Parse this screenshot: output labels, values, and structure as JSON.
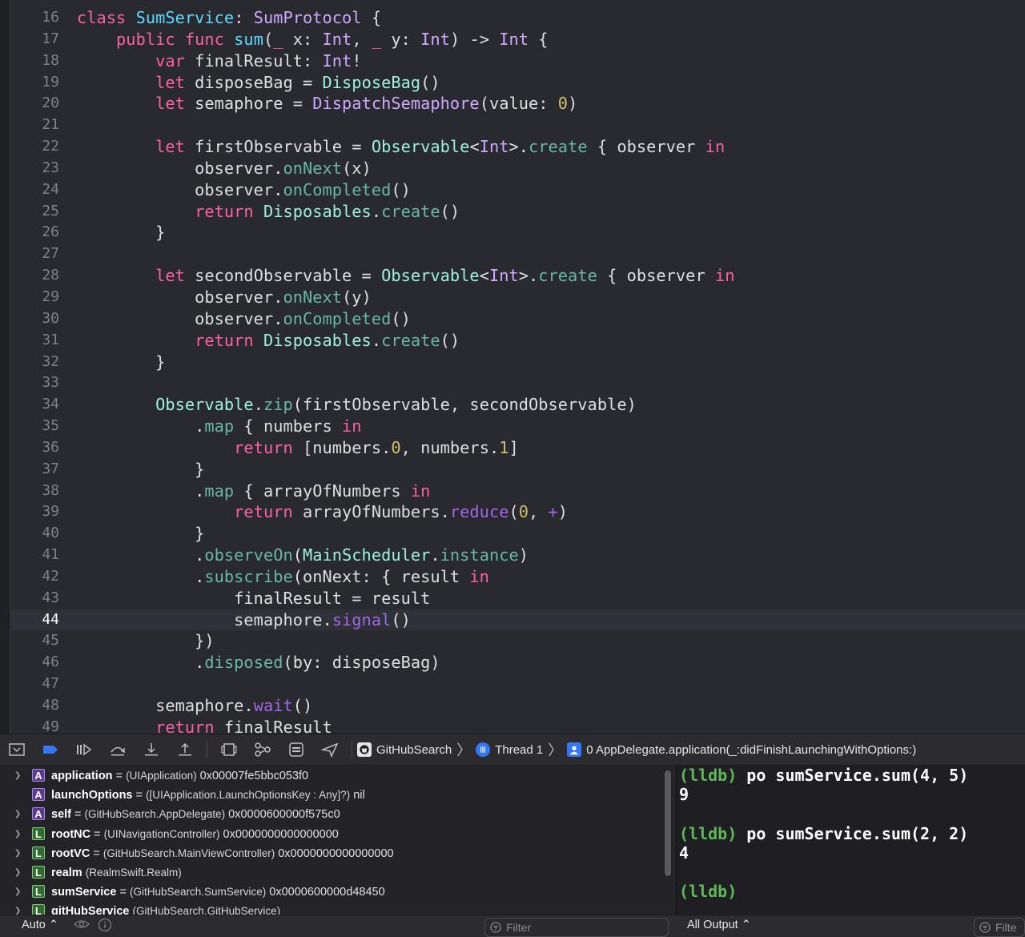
{
  "editor": {
    "current_line": 44,
    "lines": [
      {
        "n": "16",
        "t": [
          {
            "c": "kw",
            "t": "class "
          },
          {
            "c": "tyd",
            "t": "SumService"
          },
          {
            "t": ": "
          },
          {
            "c": "ty",
            "t": "SumProtocol"
          },
          {
            "t": " {"
          }
        ]
      },
      {
        "n": "17",
        "t": [
          {
            "t": "    "
          },
          {
            "c": "kw",
            "t": "public func "
          },
          {
            "c": "tyd",
            "t": "sum"
          },
          {
            "t": "("
          },
          {
            "c": "kw",
            "t": "_"
          },
          {
            "t": " x: "
          },
          {
            "c": "ty",
            "t": "Int"
          },
          {
            "t": ", "
          },
          {
            "c": "kw",
            "t": "_"
          },
          {
            "t": " y: "
          },
          {
            "c": "ty",
            "t": "Int"
          },
          {
            "t": ") -> "
          },
          {
            "c": "ty",
            "t": "Int"
          },
          {
            "t": " {"
          }
        ]
      },
      {
        "n": "18",
        "t": [
          {
            "t": "        "
          },
          {
            "c": "kw",
            "t": "var"
          },
          {
            "t": " finalResult: "
          },
          {
            "c": "ty",
            "t": "Int"
          },
          {
            "t": "!"
          }
        ]
      },
      {
        "n": "19",
        "t": [
          {
            "t": "        "
          },
          {
            "c": "kw",
            "t": "let"
          },
          {
            "t": " disposeBag = "
          },
          {
            "c": "pt",
            "t": "DisposeBag"
          },
          {
            "t": "()"
          }
        ]
      },
      {
        "n": "20",
        "t": [
          {
            "t": "        "
          },
          {
            "c": "kw",
            "t": "let"
          },
          {
            "t": " semaphore = "
          },
          {
            "c": "ty",
            "t": "DispatchSemaphore"
          },
          {
            "t": "(value: "
          },
          {
            "c": "num",
            "t": "0"
          },
          {
            "t": ")"
          }
        ]
      },
      {
        "n": "21",
        "t": []
      },
      {
        "n": "22",
        "t": [
          {
            "t": "        "
          },
          {
            "c": "kw",
            "t": "let"
          },
          {
            "t": " firstObservable = "
          },
          {
            "c": "pt",
            "t": "Observable"
          },
          {
            "t": "<"
          },
          {
            "c": "ty",
            "t": "Int"
          },
          {
            "t": ">."
          },
          {
            "c": "pn",
            "t": "create"
          },
          {
            "t": " { observer "
          },
          {
            "c": "kw",
            "t": "in"
          }
        ]
      },
      {
        "n": "23",
        "t": [
          {
            "t": "            observer."
          },
          {
            "c": "pn",
            "t": "onNext"
          },
          {
            "t": "(x)"
          }
        ]
      },
      {
        "n": "24",
        "t": [
          {
            "t": "            observer."
          },
          {
            "c": "pn",
            "t": "onCompleted"
          },
          {
            "t": "()"
          }
        ]
      },
      {
        "n": "25",
        "t": [
          {
            "t": "            "
          },
          {
            "c": "kw",
            "t": "return "
          },
          {
            "c": "pt",
            "t": "Disposables"
          },
          {
            "t": "."
          },
          {
            "c": "pn",
            "t": "create"
          },
          {
            "t": "()"
          }
        ]
      },
      {
        "n": "26",
        "t": [
          {
            "t": "        }"
          }
        ]
      },
      {
        "n": "27",
        "t": []
      },
      {
        "n": "28",
        "t": [
          {
            "t": "        "
          },
          {
            "c": "kw",
            "t": "let"
          },
          {
            "t": " secondObservable = "
          },
          {
            "c": "pt",
            "t": "Observable"
          },
          {
            "t": "<"
          },
          {
            "c": "ty",
            "t": "Int"
          },
          {
            "t": ">."
          },
          {
            "c": "pn",
            "t": "create"
          },
          {
            "t": " { observer "
          },
          {
            "c": "kw",
            "t": "in"
          }
        ]
      },
      {
        "n": "29",
        "t": [
          {
            "t": "            observer."
          },
          {
            "c": "pn",
            "t": "onNext"
          },
          {
            "t": "(y)"
          }
        ]
      },
      {
        "n": "30",
        "t": [
          {
            "t": "            observer."
          },
          {
            "c": "pn",
            "t": "onCompleted"
          },
          {
            "t": "()"
          }
        ]
      },
      {
        "n": "31",
        "t": [
          {
            "t": "            "
          },
          {
            "c": "kw",
            "t": "return "
          },
          {
            "c": "pt",
            "t": "Disposables"
          },
          {
            "t": "."
          },
          {
            "c": "pn",
            "t": "create"
          },
          {
            "t": "()"
          }
        ]
      },
      {
        "n": "32",
        "t": [
          {
            "t": "        }"
          }
        ]
      },
      {
        "n": "33",
        "t": []
      },
      {
        "n": "34",
        "t": [
          {
            "t": "        "
          },
          {
            "c": "pt",
            "t": "Observable"
          },
          {
            "t": "."
          },
          {
            "c": "pn",
            "t": "zip"
          },
          {
            "t": "(firstObservable, secondObservable)"
          }
        ]
      },
      {
        "n": "35",
        "t": [
          {
            "t": "            ."
          },
          {
            "c": "pn",
            "t": "map"
          },
          {
            "t": " { numbers "
          },
          {
            "c": "kw",
            "t": "in"
          }
        ]
      },
      {
        "n": "36",
        "t": [
          {
            "t": "                "
          },
          {
            "c": "kw",
            "t": "return"
          },
          {
            "t": " [numbers."
          },
          {
            "c": "num",
            "t": "0"
          },
          {
            "t": ", numbers."
          },
          {
            "c": "num",
            "t": "1"
          },
          {
            "t": "]"
          }
        ]
      },
      {
        "n": "37",
        "t": [
          {
            "t": "            }"
          }
        ]
      },
      {
        "n": "38",
        "t": [
          {
            "t": "            ."
          },
          {
            "c": "pn",
            "t": "map"
          },
          {
            "t": " { arrayOfNumbers "
          },
          {
            "c": "kw",
            "t": "in"
          }
        ]
      },
      {
        "n": "39",
        "t": [
          {
            "t": "                "
          },
          {
            "c": "kw",
            "t": "return"
          },
          {
            "t": " arrayOfNumbers."
          },
          {
            "c": "pj",
            "t": "reduce"
          },
          {
            "t": "("
          },
          {
            "c": "num",
            "t": "0"
          },
          {
            "t": ", "
          },
          {
            "c": "pj",
            "t": "+"
          },
          {
            "t": ")"
          }
        ]
      },
      {
        "n": "40",
        "t": [
          {
            "t": "            }"
          }
        ]
      },
      {
        "n": "41",
        "t": [
          {
            "t": "            ."
          },
          {
            "c": "pn",
            "t": "observeOn"
          },
          {
            "t": "("
          },
          {
            "c": "pt",
            "t": "MainScheduler"
          },
          {
            "t": "."
          },
          {
            "c": "pn",
            "t": "instance"
          },
          {
            "t": ")"
          }
        ]
      },
      {
        "n": "42",
        "t": [
          {
            "t": "            ."
          },
          {
            "c": "pn",
            "t": "subscribe"
          },
          {
            "t": "(onNext: { result "
          },
          {
            "c": "kw",
            "t": "in"
          }
        ]
      },
      {
        "n": "43",
        "t": [
          {
            "t": "                finalResult = result"
          }
        ]
      },
      {
        "n": "44",
        "t": [
          {
            "t": "                semaphore."
          },
          {
            "c": "pj",
            "t": "signal"
          },
          {
            "t": "()"
          }
        ]
      },
      {
        "n": "45",
        "t": [
          {
            "t": "            })"
          }
        ]
      },
      {
        "n": "46",
        "t": [
          {
            "t": "            ."
          },
          {
            "c": "pn",
            "t": "disposed"
          },
          {
            "t": "(by: disposeBag)"
          }
        ]
      },
      {
        "n": "47",
        "t": []
      },
      {
        "n": "48",
        "t": [
          {
            "t": "        semaphore."
          },
          {
            "c": "pj",
            "t": "wait"
          },
          {
            "t": "()"
          }
        ]
      },
      {
        "n": "49",
        "t": [
          {
            "t": "        "
          },
          {
            "c": "kw",
            "t": "return"
          },
          {
            "t": " finalResult"
          }
        ]
      }
    ]
  },
  "debugbar": {
    "buttons": [
      "hide-debug-area-icon",
      "breakpoints-toggle-icon",
      "continue-icon",
      "step-over-icon",
      "step-into-icon",
      "step-out-icon",
      "view-hierarchy-icon",
      "memory-graph-icon",
      "environment-overrides-icon",
      "location-simulate-icon"
    ],
    "breadcrumb": {
      "target": "GitHubSearch",
      "thread": "Thread 1",
      "frame": "0 AppDelegate.application(_:didFinishLaunchingWithOptions:)"
    },
    "accent": "#3478f6"
  },
  "variables": [
    {
      "disc": true,
      "badge": "A",
      "name": "application",
      "rest": " = ",
      "type": "(UIApplication)",
      "value": " 0x00007fe5bbc053f0"
    },
    {
      "disc": false,
      "badge": "A",
      "name": "launchOptions",
      "rest": " = ",
      "type": "([UIApplication.LaunchOptionsKey : Any]?)",
      "value": " nil"
    },
    {
      "disc": true,
      "badge": "A",
      "name": "self",
      "rest": " = ",
      "type": "(GitHubSearch.AppDelegate)",
      "value": " 0x0000600000f575c0"
    },
    {
      "disc": true,
      "badge": "L",
      "name": "rootNC",
      "rest": " = ",
      "type": "(UINavigationController)",
      "value": " 0x0000000000000000"
    },
    {
      "disc": true,
      "badge": "L",
      "name": "rootVC",
      "rest": " = ",
      "type": "(GitHubSearch.MainViewController)",
      "value": " 0x0000000000000000"
    },
    {
      "disc": true,
      "badge": "L",
      "name": "realm",
      "rest": " ",
      "type": "(RealmSwift.Realm)",
      "value": ""
    },
    {
      "disc": true,
      "badge": "L",
      "name": "sumService",
      "rest": " = ",
      "type": "(GitHubSearch.SumService)",
      "value": " 0x0000600000d48450"
    },
    {
      "disc": true,
      "badge": "L",
      "name": "gitHubService",
      "rest": " ",
      "type": "(GitHubSearch.GitHubService)",
      "value": ""
    }
  ],
  "console": {
    "lines": [
      {
        "prompt": "(lldb)",
        "cmd": " po sumService.sum(4, 5)"
      },
      {
        "prompt": "",
        "cmd": "9"
      },
      {
        "prompt": "",
        "cmd": ""
      },
      {
        "prompt": "(lldb)",
        "cmd": " po sumService.sum(2, 2)"
      },
      {
        "prompt": "",
        "cmd": "4"
      },
      {
        "prompt": "",
        "cmd": ""
      },
      {
        "prompt": "(lldb)",
        "cmd": ""
      }
    ]
  },
  "bottombar": {
    "scope_label": "Auto ⌃",
    "filter_placeholder": "Filter",
    "output_label": "All Output ⌃",
    "console_filter_placeholder": "Filte"
  }
}
